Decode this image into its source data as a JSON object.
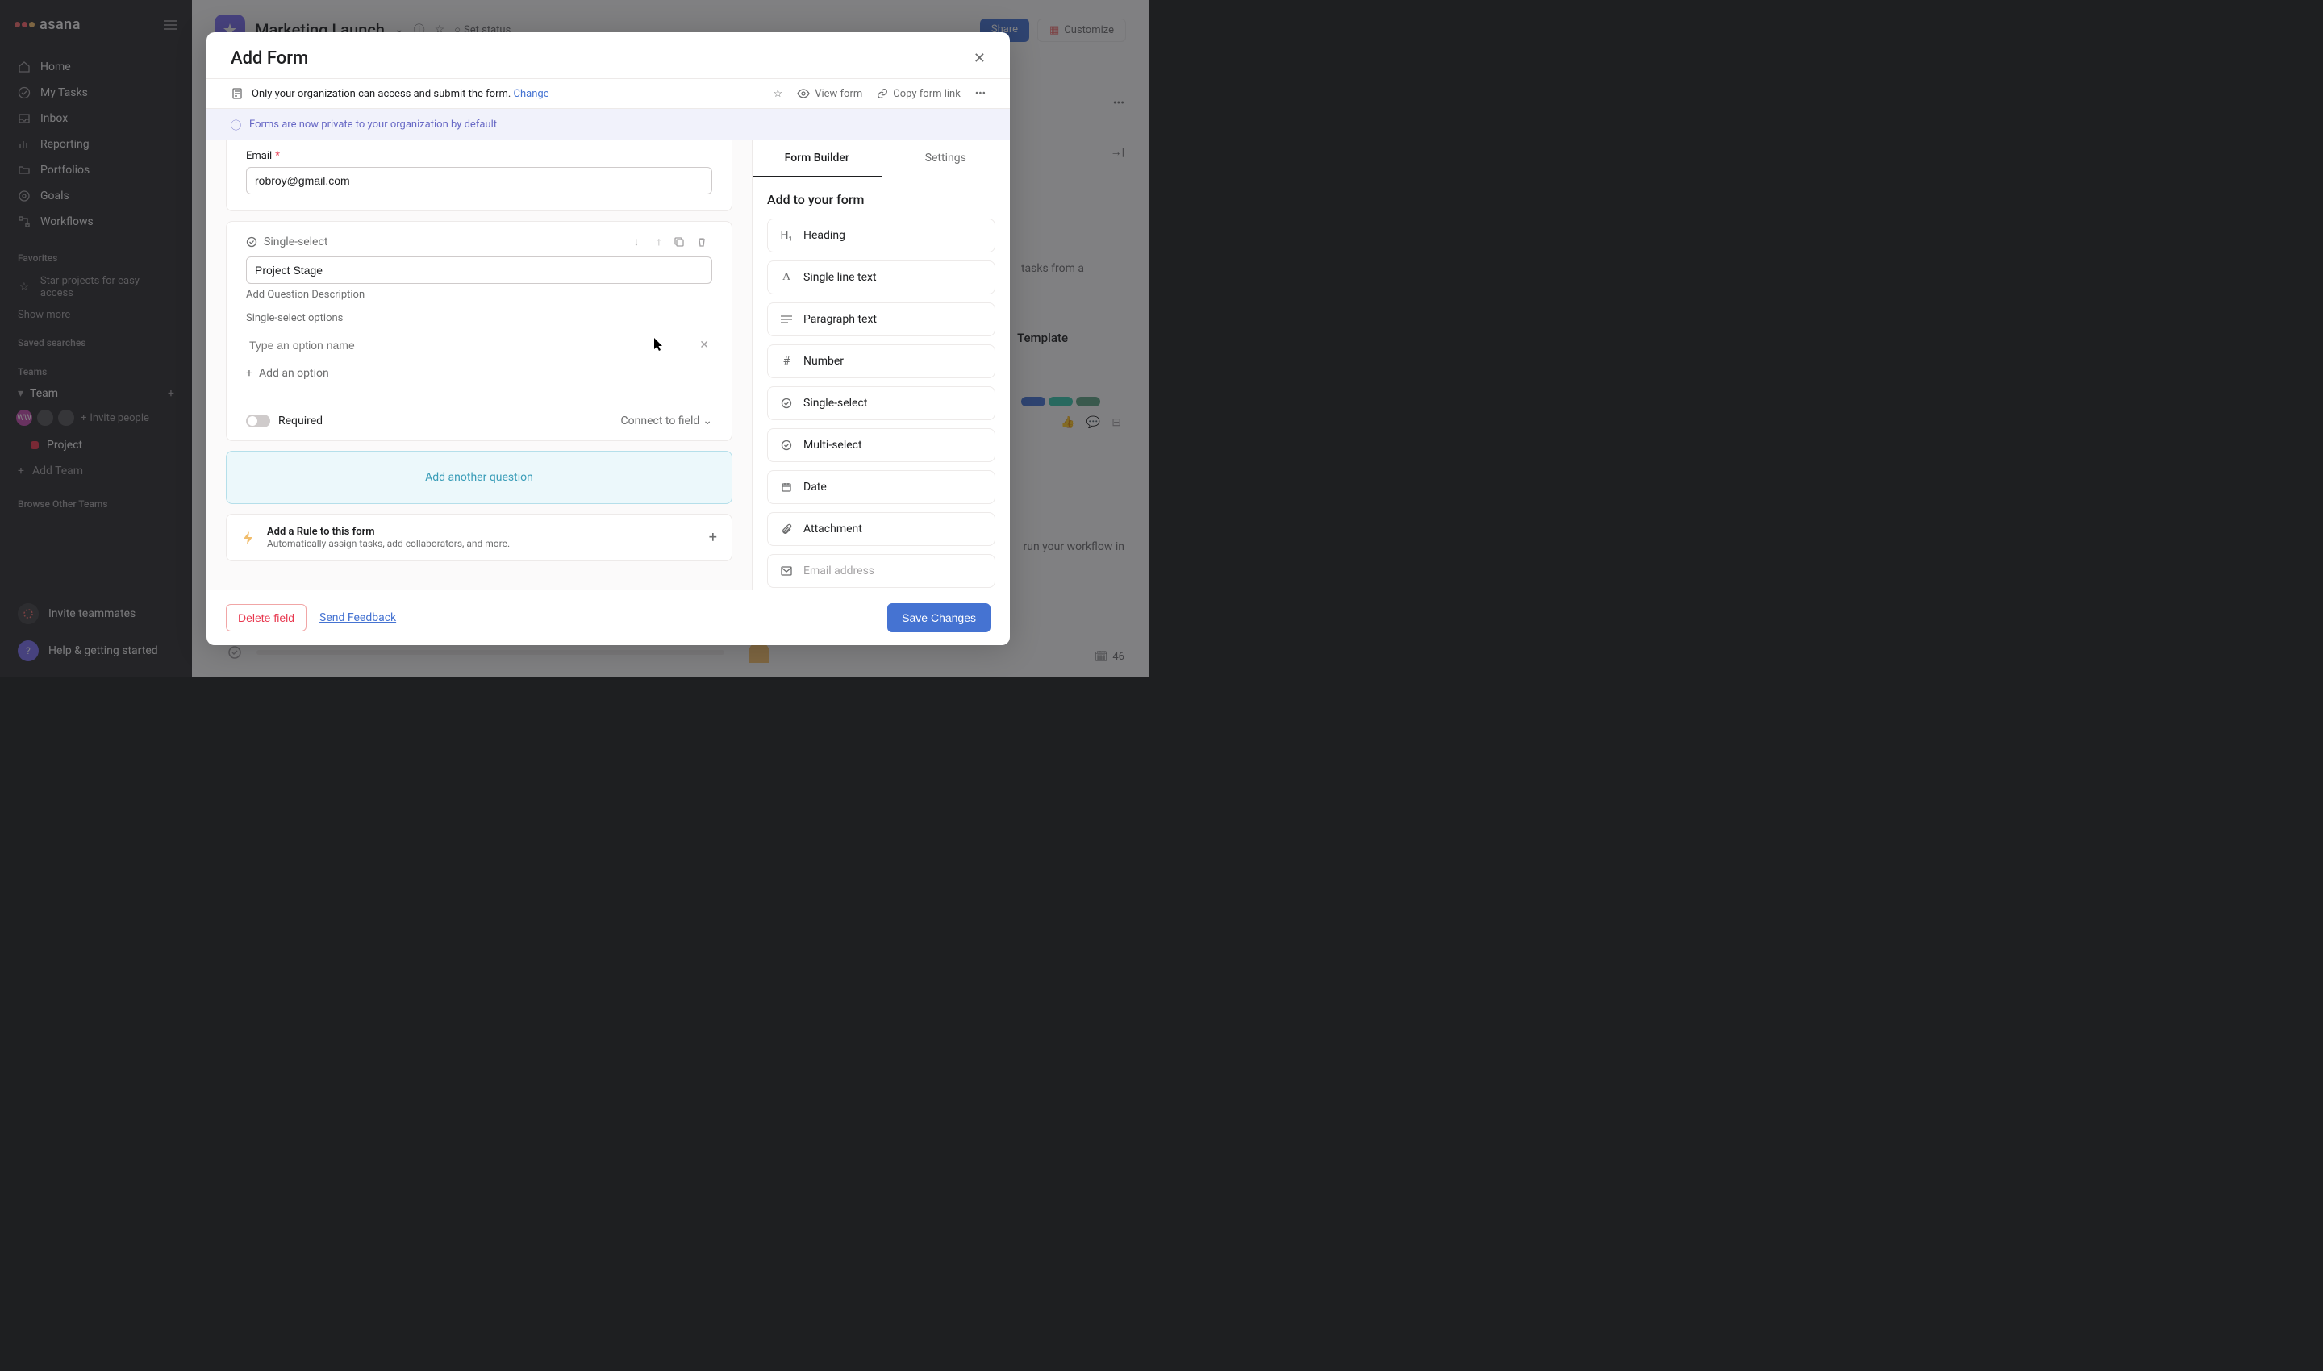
{
  "app": {
    "name": "asana"
  },
  "sidebar": {
    "nav": [
      {
        "label": "Home"
      },
      {
        "label": "My Tasks"
      },
      {
        "label": "Inbox"
      },
      {
        "label": "Reporting"
      },
      {
        "label": "Portfolios"
      },
      {
        "label": "Goals"
      },
      {
        "label": "Workflows"
      }
    ],
    "favorites_label": "Favorites",
    "favorites_hint": "Star projects for easy access",
    "show_more": "Show more",
    "saved_searches": "Saved searches",
    "teams_label": "Teams",
    "team_name": "Team",
    "invite_people": "Invite people",
    "avatar_initials": "WW",
    "project_name": "Project",
    "add_team": "Add Team",
    "browse_other": "Browse Other Teams",
    "invite_teammates": "Invite teammates",
    "help": "Help & getting started"
  },
  "header": {
    "title": "Marketing Launch",
    "set_status": "Set status",
    "share": "Share",
    "customize": "Customize",
    "count": "46"
  },
  "bg": {
    "tasks_from": "tasks from a",
    "template": "Template",
    "run_workflow": "run your workflow in"
  },
  "modal": {
    "title": "Add Form",
    "access_text": "Only your organization can access and submit the form.",
    "change": "Change",
    "view_form": "View form",
    "copy_link": "Copy form link",
    "info_banner": "Forms are now private to your organization by default",
    "email_label": "Email",
    "email_value": "robroy@gmail.com",
    "question": {
      "type": "Single-select",
      "title": "Project Stage",
      "add_description": "Add Question Description",
      "options_label": "Single-select options",
      "option_placeholder": "Type an option name",
      "add_option": "Add an option",
      "required": "Required",
      "connect": "Connect to field"
    },
    "add_another": "Add another question",
    "rule_title": "Add a Rule to this form",
    "rule_sub": "Automatically assign tasks, add collaborators, and more.",
    "panel": {
      "tab1": "Form Builder",
      "tab2": "Settings",
      "title": "Add to your form",
      "fields": [
        {
          "label": "Heading",
          "icon": "H1"
        },
        {
          "label": "Single line text",
          "icon": "A"
        },
        {
          "label": "Paragraph text",
          "icon": "para"
        },
        {
          "label": "Number",
          "icon": "#"
        },
        {
          "label": "Single-select",
          "icon": "circ"
        },
        {
          "label": "Multi-select",
          "icon": "circ"
        },
        {
          "label": "Date",
          "icon": "cal"
        },
        {
          "label": "Attachment",
          "icon": "clip"
        },
        {
          "label": "Email address",
          "icon": "mail",
          "disabled": true
        }
      ]
    },
    "footer": {
      "delete": "Delete field",
      "feedback": "Send Feedback",
      "save": "Save Changes"
    }
  }
}
